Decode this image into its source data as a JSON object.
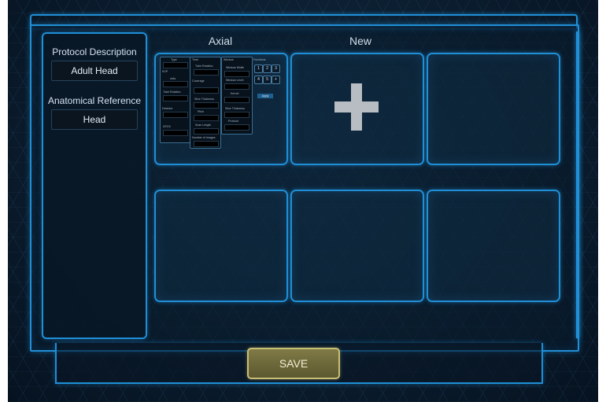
{
  "sidebar": {
    "protocol_label": "Protocol Description",
    "protocol_value": "Adult Head",
    "anatomical_label": "Anatomical Reference",
    "anatomical_value": "Head"
  },
  "columns": {
    "axial": "Axial",
    "new": "New"
  },
  "preview": {
    "type_label": "Type",
    "kvp_label": "KVP",
    "mas_label": "mAs",
    "tube_label": "Tube Rotation",
    "detector_label": "Detector",
    "dfov_label": "DFOV",
    "time_label": "Time",
    "coverage_label": "Coverage",
    "slice_label": "Slice Thickness",
    "pitch_label": "Pitch",
    "scan_length_label": "Scan Length",
    "images_label": "Number of Images",
    "window_label": "Window",
    "window_width": "Window Width",
    "window_level": "Window Level",
    "kernel_label": "Kernel",
    "slice_thickness": "Slice Thickness",
    "protocol": "Protocol",
    "functions_label": "Functions",
    "nums": [
      "1",
      "2",
      "3",
      "4",
      "5",
      "+"
    ],
    "apply_label": "Apply"
  },
  "save_label": "SAVE"
}
